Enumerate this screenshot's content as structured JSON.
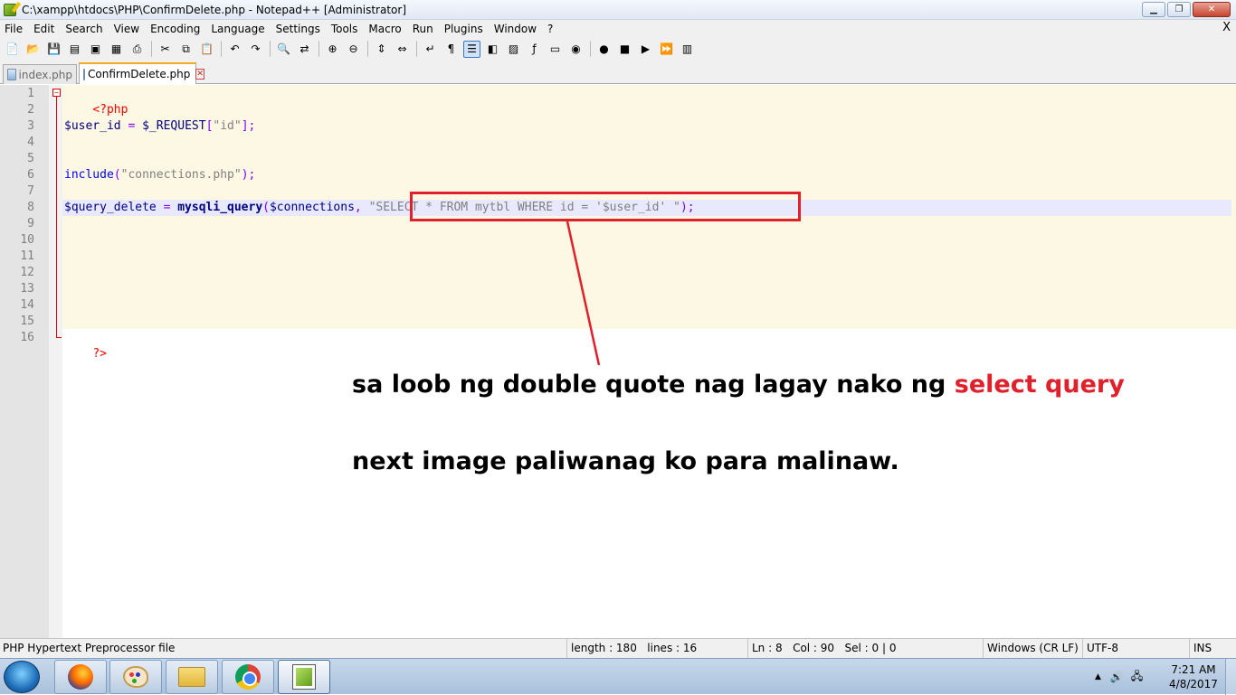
{
  "window": {
    "title": "C:\\xampp\\htdocs\\PHP\\ConfirmDelete.php - Notepad++ [Administrator]",
    "controls": {
      "minimize": "▁",
      "maximize": "❐",
      "close": "✕"
    }
  },
  "menu": {
    "items": [
      "File",
      "Edit",
      "Search",
      "View",
      "Encoding",
      "Language",
      "Settings",
      "Tools",
      "Macro",
      "Run",
      "Plugins",
      "Window",
      "?"
    ],
    "close": "X"
  },
  "toolbar": {
    "buttons": [
      "new-file-icon",
      "open-file-icon",
      "save-icon",
      "save-all-icon",
      "close-icon",
      "close-all-icon",
      "print-icon",
      "sep",
      "cut-icon",
      "copy-icon",
      "paste-icon",
      "sep",
      "undo-icon",
      "redo-icon",
      "sep",
      "find-icon",
      "replace-icon",
      "sep",
      "zoom-in-icon",
      "zoom-out-icon",
      "sep",
      "sync-vertical-icon",
      "sync-horizontal-icon",
      "sep",
      "word-wrap-icon",
      "show-all-chars-icon",
      "indent-guide-icon",
      "user-language-icon",
      "doc-map-icon",
      "function-list-icon",
      "folder-workspace-icon",
      "monitoring-icon",
      "sep",
      "record-macro-icon",
      "stop-record-icon",
      "play-macro-icon",
      "run-macro-multiple-icon",
      "save-macro-icon"
    ],
    "glyphs": {
      "new-file-icon": "📄",
      "open-file-icon": "📂",
      "save-icon": "💾",
      "save-all-icon": "▤",
      "close-icon": "▣",
      "close-all-icon": "▦",
      "print-icon": "⎙",
      "cut-icon": "✂",
      "copy-icon": "⧉",
      "paste-icon": "📋",
      "undo-icon": "↶",
      "redo-icon": "↷",
      "find-icon": "🔍",
      "replace-icon": "⇄",
      "zoom-in-icon": "⊕",
      "zoom-out-icon": "⊖",
      "sync-vertical-icon": "⇕",
      "sync-horizontal-icon": "⇔",
      "word-wrap-icon": "↵",
      "show-all-chars-icon": "¶",
      "indent-guide-icon": "☰",
      "user-language-icon": "◧",
      "doc-map-icon": "▨",
      "function-list-icon": "ƒ",
      "folder-workspace-icon": "▭",
      "monitoring-icon": "◉",
      "record-macro-icon": "●",
      "stop-record-icon": "■",
      "play-macro-icon": "▶",
      "run-macro-multiple-icon": "⏩",
      "save-macro-icon": "▥"
    },
    "active": "indent-guide-icon"
  },
  "tabs": [
    {
      "label": "index.php",
      "close": "✕"
    },
    {
      "label": "ConfirmDelete.php",
      "close": "✕"
    }
  ],
  "editor": {
    "line_numbers": [
      "1",
      "2",
      "3",
      "4",
      "5",
      "6",
      "7",
      "8",
      "9",
      "10",
      "11",
      "12",
      "13",
      "14",
      "15",
      "16"
    ],
    "fold_open": "−",
    "lines": {
      "l1": {
        "tag": "<?php"
      },
      "l3": {
        "var": "$user_id",
        "op1": " = ",
        "var2": "$_REQUEST",
        "op2": "[",
        "str": "\"id\"",
        "op3": "];"
      },
      "l6": {
        "kw": "include",
        "op1": "(",
        "str": "\"connections.php\"",
        "op2": ");"
      },
      "l8": {
        "var": "$query_delete",
        "op1": " = ",
        "fn": "mysqli_query",
        "op2": "(",
        "var2": "$connections",
        "op3": ", ",
        "str": "\"SELECT * FROM mytbl WHERE id = '$user_id' \"",
        "op4": ");"
      },
      "l16": {
        "tag": "?>"
      }
    }
  },
  "annotation": {
    "line1_part1": "sa loob ng double quote nag lagay nako ng ",
    "line1_red": "select query",
    "line2": "next image paliwanag ko para malinaw.",
    "color": "#e0202a"
  },
  "statusbar": {
    "file_type": "PHP Hypertext Preprocessor file",
    "length": "length : 180",
    "lines": "lines : 16",
    "ln": "Ln : 8",
    "col": "Col : 90",
    "sel": "Sel : 0 | 0",
    "eol": "Windows (CR LF)",
    "encoding": "UTF-8",
    "mode": "INS"
  },
  "taskbar": {
    "apps": [
      "firefox-icon",
      "paint-icon",
      "explorer-folder-icon",
      "chrome-icon",
      "notepadpp-icon"
    ],
    "tray": {
      "arrow": "▲",
      "volume": "🔊",
      "network": "🖧"
    },
    "time": "7:21 AM",
    "date": "4/8/2017"
  }
}
